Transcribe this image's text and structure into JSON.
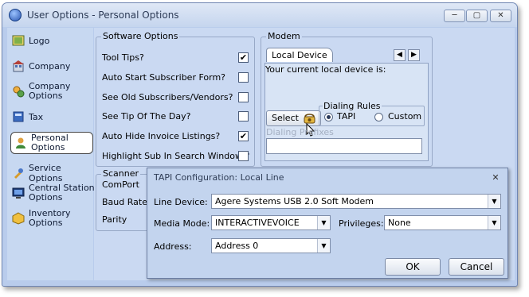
{
  "window": {
    "title": "User Options - Personal Options",
    "buttons": {
      "minimize": "─",
      "maximize": "▢",
      "close": "✕"
    }
  },
  "sidebar": {
    "items": [
      {
        "label": "Logo",
        "icon": "logo-icon"
      },
      {
        "label": "Company",
        "icon": "company-icon"
      },
      {
        "label": "Company Options",
        "icon": "company-options-icon"
      },
      {
        "label": "Tax",
        "icon": "tax-icon"
      },
      {
        "label": "Personal Options",
        "icon": "personal-options-icon",
        "selected": true
      },
      {
        "label": "Service Options",
        "icon": "service-options-icon"
      },
      {
        "label": "Central Station Options",
        "icon": "central-station-icon"
      },
      {
        "label": "Inventory Options",
        "icon": "inventory-icon"
      }
    ]
  },
  "software_options": {
    "title": "Software Options",
    "items": [
      {
        "label": "Tool Tips?",
        "checked": true,
        "mark": "✔"
      },
      {
        "label": "Auto Start Subscriber Form?",
        "checked": false,
        "mark": ""
      },
      {
        "label": "See Old Subscribers/Vendors?",
        "checked": false,
        "mark": ""
      },
      {
        "label": "See Tip Of The Day?",
        "checked": false,
        "mark": ""
      },
      {
        "label": "Auto Hide Invoice Listings?",
        "checked": true,
        "mark": "✔"
      },
      {
        "label": "Highlight Sub In Search Window ?",
        "checked": false,
        "mark": ""
      }
    ]
  },
  "scanner": {
    "title": "Scanner",
    "com_port": "ComPort",
    "baud_rate": "Baud Rate",
    "parity": "Parity"
  },
  "modem": {
    "title": "Modem",
    "tab": "Local Device",
    "current_device_text": "Your current local device is:",
    "select_label": "Select",
    "dialing_rules": {
      "title": "Dialing Rules",
      "options": [
        "TAPI",
        "Custom"
      ],
      "selected": "TAPI"
    },
    "dialing_prefixes_label": "Dialing Prefixes",
    "nav": {
      "prev": "◀",
      "next": "▶"
    }
  },
  "tapi_dialog": {
    "title": "TAPI Configuration: Local Line",
    "close": "✕",
    "line_device": {
      "label": "Line Device:",
      "value": "Agere Systems USB 2.0 Soft Modem"
    },
    "media_mode": {
      "label": "Media Mode:",
      "value": "INTERACTIVEVOICE"
    },
    "privileges": {
      "label": "Privileges:",
      "value": "None"
    },
    "address": {
      "label": "Address:",
      "value": "Address 0"
    },
    "ok": "OK",
    "cancel": "Cancel",
    "dropdown_arrow": "▼"
  }
}
